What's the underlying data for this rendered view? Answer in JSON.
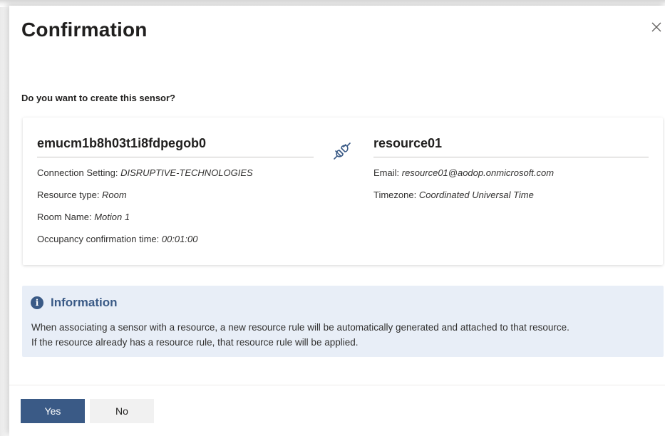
{
  "dialog": {
    "title": "Confirmation",
    "question": "Do you want to create this sensor?"
  },
  "sensor": {
    "name": "emucm1b8h03t1i8fdpegob0",
    "fields": [
      {
        "label": "Connection Setting: ",
        "value": "DISRUPTIVE-TECHNOLOGIES"
      },
      {
        "label": "Resource type: ",
        "value": "Room"
      },
      {
        "label": "Room Name: ",
        "value": "Motion 1"
      },
      {
        "label": "Occupancy confirmation time: ",
        "value": "00:01:00"
      }
    ]
  },
  "resource": {
    "name": "resource01",
    "fields": [
      {
        "label": "Email: ",
        "value": "resource01@aodop.onmicrosoft.com"
      },
      {
        "label": "Timezone: ",
        "value": "Coordinated Universal Time"
      }
    ]
  },
  "info": {
    "title": "Information",
    "icon": "info-icon",
    "line1": "When associating a sensor with a resource, a new resource rule will be automatically generated and attached to that resource.",
    "line2": "If the resource already has a resource rule, that resource rule will be applied."
  },
  "buttons": {
    "yes": "Yes",
    "no": "No"
  },
  "colors": {
    "primary": "#3a5a86",
    "info_bg": "#e8eef7"
  }
}
